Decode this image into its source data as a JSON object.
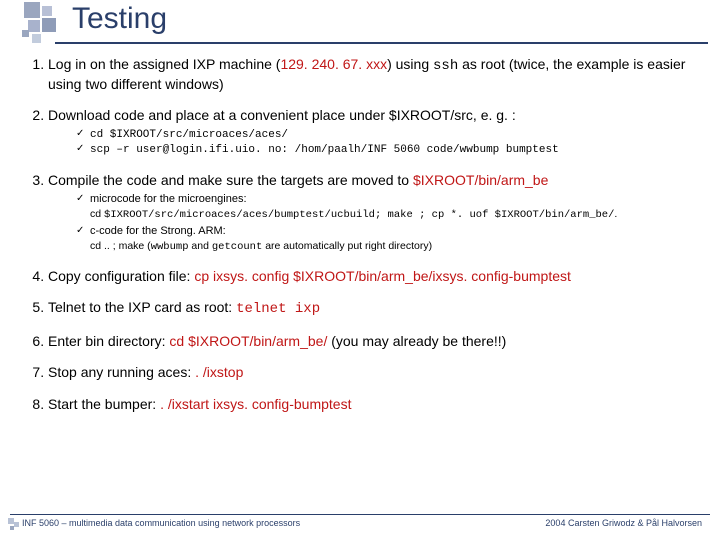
{
  "title": "Testing",
  "items": [
    {
      "pre": "Log in on the assigned IXP machine (",
      "red": "129. 240. 67. xxx",
      "mid": ") using ",
      "mono": "ssh",
      "post": " as root (twice, the example is easier using two different windows)"
    },
    {
      "text": "Download code and place at a convenient place under $IXROOT/src, e. g. :",
      "sub": [
        {
          "mono": "cd $IXROOT/src/microaces/aces/"
        },
        {
          "mono": "scp –r user@login.ifi.uio. no: /hom/paalh/INF 5060 code/wwbump bumptest"
        }
      ]
    },
    {
      "pre": "Compile the code and make sure the targets are moved to ",
      "red": "$IXROOT/bin/arm_be",
      "sub": [
        {
          "text": "microcode for the microengines:",
          "detail_pre": "cd ",
          "detail_mono": "$IXROOT/src/microaces/aces/bumptest/ucbuild; make ; cp *. uof $IXROOT/bin/arm_be/",
          "detail_post": "."
        },
        {
          "text": "c-code for the Strong. ARM:",
          "detail_pre": "cd .. ; make          (",
          "detail_mono": "wwbump",
          "detail_mid": " and ",
          "detail_mono2": "getcount",
          "detail_post": " are automatically put right directory)"
        }
      ]
    },
    {
      "pre": "Copy configuration file: ",
      "red": "cp ixsys. config $IXROOT/bin/arm_be/ixsys. config-bumptest"
    },
    {
      "pre": "Telnet to the IXP card as root: ",
      "red_mono": "telnet ixp"
    },
    {
      "pre": "Enter bin directory: ",
      "red": "cd $IXROOT/bin/arm_be/",
      "tail": "     (you may already be there!!)"
    },
    {
      "pre": "Stop any running aces: ",
      "red": ". /ixstop"
    },
    {
      "pre": "Start the bumper: ",
      "red": ". /ixstart ixsys. config-bumptest"
    }
  ],
  "footer": {
    "left": "INF 5060 – multimedia data communication using network processors",
    "right": "2004  Carsten Griwodz & Pål Halvorsen"
  }
}
